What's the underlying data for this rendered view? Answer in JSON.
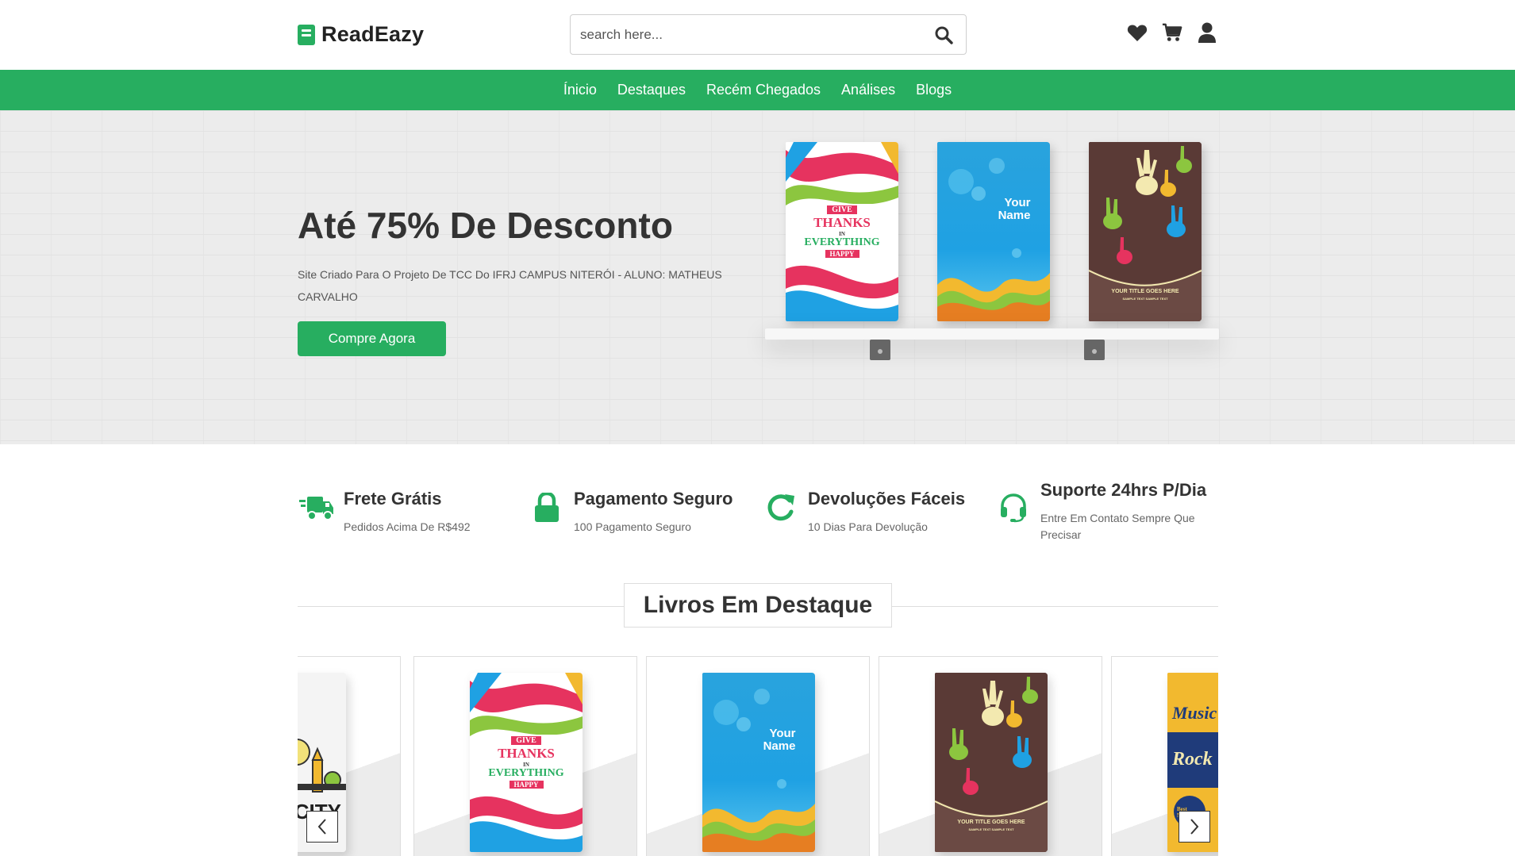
{
  "brand": {
    "name": "ReadEazy",
    "accent": "#27ae60"
  },
  "search": {
    "placeholder": "search here...",
    "value": ""
  },
  "header_icons": [
    "heart-icon",
    "cart-icon",
    "user-icon"
  ],
  "nav": {
    "items": [
      {
        "label": "Ínicio"
      },
      {
        "label": "Destaques"
      },
      {
        "label": "Recém Chegados"
      },
      {
        "label": "Análises"
      },
      {
        "label": "Blogs"
      }
    ]
  },
  "hero": {
    "title": "Até 75% De Desconto",
    "subtitle": "Site Criado Para O Projeto De TCC Do IFRJ CAMPUS NITERÓI - ALUNO: MATHEUS CARVALHO",
    "button_label": "Compre Agora"
  },
  "features": [
    {
      "icon": "truck-icon",
      "title": "Frete Grátis",
      "desc": "Pedidos Acima De R$492"
    },
    {
      "icon": "lock-icon",
      "title": "Pagamento Seguro",
      "desc": "100 Pagamento Seguro"
    },
    {
      "icon": "redo-icon",
      "title": "Devoluções Fáceis",
      "desc": "10 Dias Para Devolução"
    },
    {
      "icon": "headset-icon",
      "title": "Suporte 24hrs P/Dia",
      "desc": "Entre Em Contato Sempre Que Precisar"
    }
  ],
  "section": {
    "title": "Livros Em Destaque"
  },
  "covers": {
    "thanks": {
      "give": "GIVE",
      "thanks": "THANKS",
      "in": "IN",
      "everything": "EVERYTHING",
      "happy": "HAPPY"
    },
    "blue": {
      "line1": "Your",
      "line2": "Name"
    },
    "hands": {
      "title": "YOUR TITLE GOES HERE",
      "sub": "SAMPLE TEXT SAMPLE TEXT"
    },
    "city": {
      "text": "T CITY"
    },
    "music": {
      "top": "Music",
      "mid": "Rock",
      "badge": "Best MUSIC"
    }
  }
}
